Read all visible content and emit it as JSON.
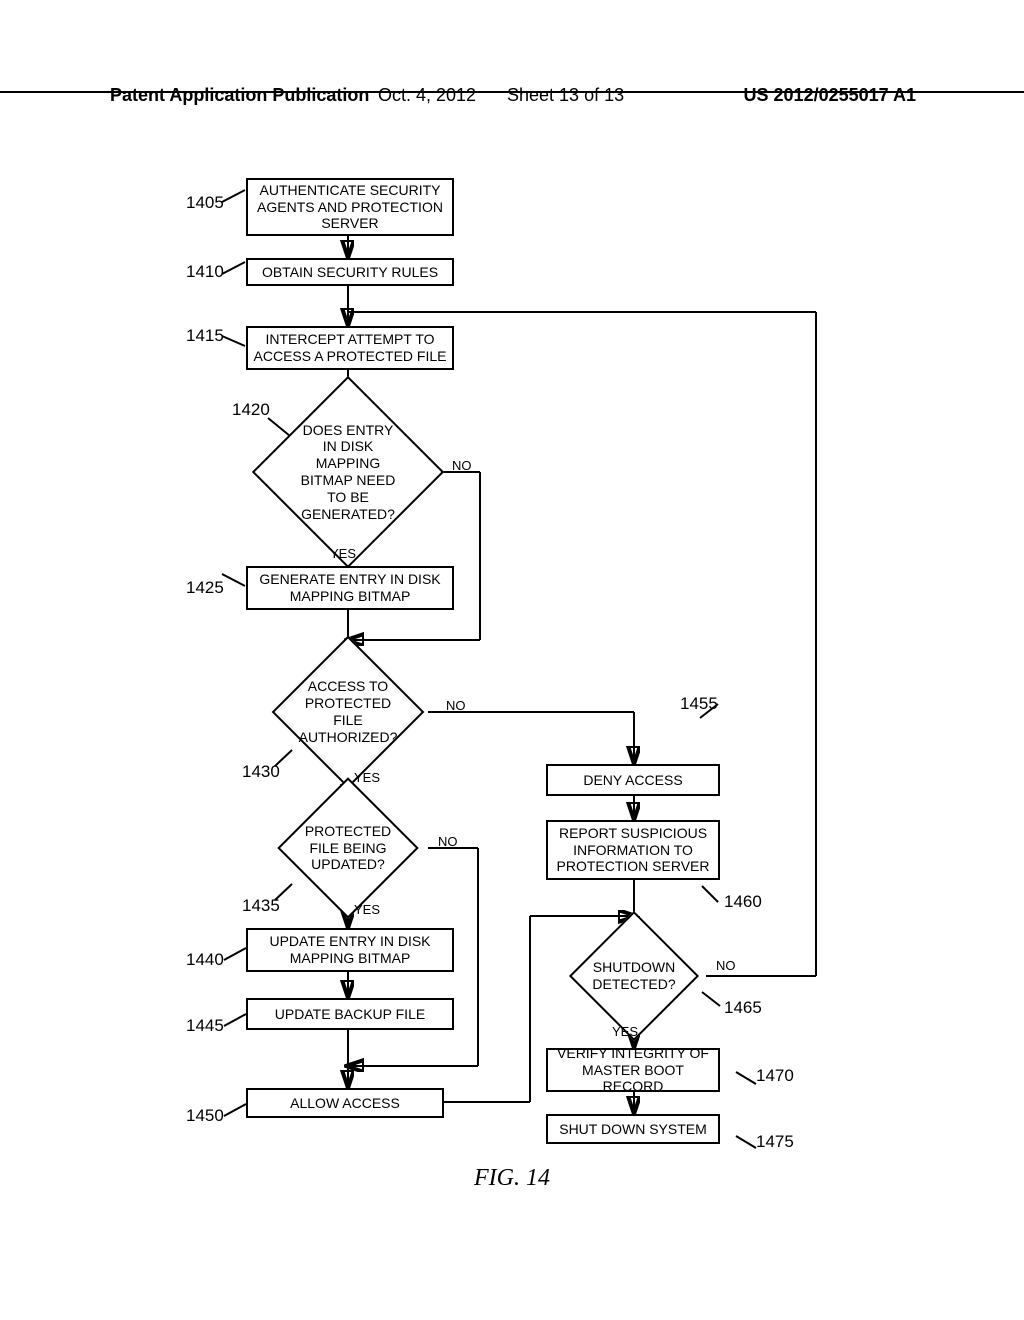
{
  "header": {
    "left": "Patent Application Publication",
    "date": "Oct. 4, 2012",
    "sheet": "Sheet 13 of 13",
    "pubno": "US 2012/0255017 A1"
  },
  "figure_title": "FIG. 14",
  "nodes": {
    "n1405": "AUTHENTICATE SECURITY AGENTS AND PROTECTION SERVER",
    "n1410": "OBTAIN SECURITY RULES",
    "n1415": "INTERCEPT ATTEMPT TO ACCESS A PROTECTED FILE",
    "d1420": "DOES ENTRY IN DISK MAPPING BITMAP NEED TO BE GENERATED?",
    "n1425": "GENERATE ENTRY IN DISK MAPPING BITMAP",
    "d1430": "ACCESS TO PROTECTED FILE AUTHORIZED?",
    "d1435": "PROTECTED FILE BEING UPDATED?",
    "n1440": "UPDATE ENTRY IN DISK MAPPING BITMAP",
    "n1445": "UPDATE BACKUP FILE",
    "n1450": "ALLOW ACCESS",
    "n1455": "DENY ACCESS",
    "n1460": "REPORT SUSPICIOUS INFORMATION TO PROTECTION SERVER",
    "d1465": "SHUTDOWN DETECTED?",
    "n1470": "VERIFY INTEGRITY OF MASTER BOOT RECORD",
    "n1475": "SHUT DOWN SYSTEM"
  },
  "labels": {
    "r1405": "1405",
    "r1410": "1410",
    "r1415": "1415",
    "r1420": "1420",
    "r1425": "1425",
    "r1430": "1430",
    "r1435": "1435",
    "r1440": "1440",
    "r1445": "1445",
    "r1450": "1450",
    "r1455": "1455",
    "r1460": "1460",
    "r1465": "1465",
    "r1470": "1470",
    "r1475": "1475"
  },
  "flow": {
    "yes": "YES",
    "no": "NO"
  }
}
